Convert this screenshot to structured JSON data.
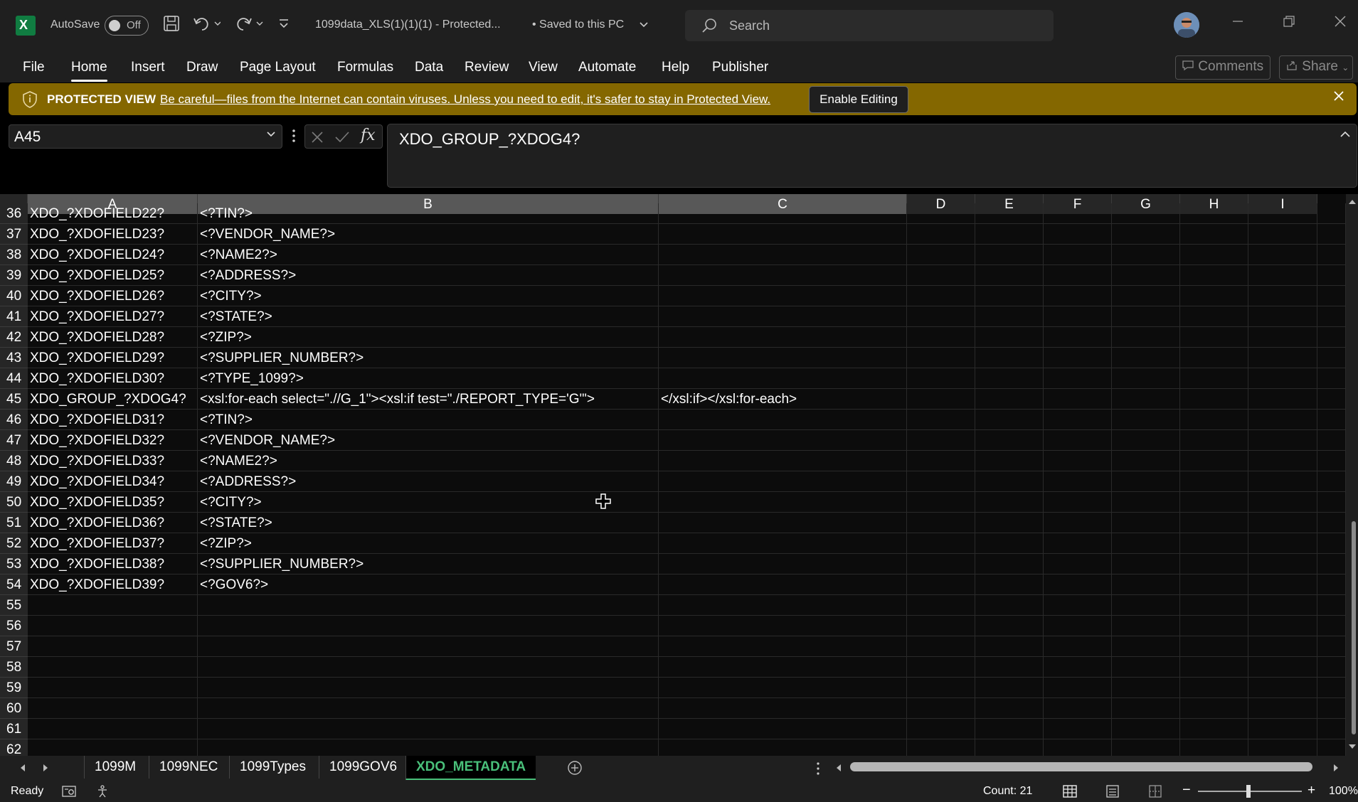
{
  "app": {
    "autosave_label": "AutoSave",
    "autosave_state": "Off",
    "file_title": "1099data_XLS(1)(1)(1)  -  Protected...",
    "save_status": "• Saved to this PC",
    "search_placeholder": "Search"
  },
  "ribbon": {
    "tabs": [
      "File",
      "Home",
      "Insert",
      "Draw",
      "Page Layout",
      "Formulas",
      "Data",
      "Review",
      "View",
      "Automate",
      "Help",
      "Publisher"
    ],
    "active_tab": "Home",
    "comments_label": "Comments",
    "share_label": "Share"
  },
  "protected_view": {
    "title": "PROTECTED VIEW",
    "message": "Be careful—files from the Internet can contain viruses. Unless you need to edit, it's safer to stay in Protected View.",
    "button": "Enable Editing"
  },
  "formula_bar": {
    "name_box": "A45",
    "fx_label": "fx",
    "value": "XDO_GROUP_?XDOG4?"
  },
  "sheet": {
    "columns": [
      "A",
      "B",
      "C",
      "D",
      "E",
      "F",
      "G",
      "H",
      "I"
    ],
    "selected_column": "A",
    "rows": [
      {
        "n": "36",
        "a": "XDO_?XDOFIELD22?",
        "b": "<?TIN?>",
        "c": ""
      },
      {
        "n": "37",
        "a": "XDO_?XDOFIELD23?",
        "b": "<?VENDOR_NAME?>",
        "c": ""
      },
      {
        "n": "38",
        "a": "XDO_?XDOFIELD24?",
        "b": "<?NAME2?>",
        "c": ""
      },
      {
        "n": "39",
        "a": "XDO_?XDOFIELD25?",
        "b": "<?ADDRESS?>",
        "c": ""
      },
      {
        "n": "40",
        "a": "XDO_?XDOFIELD26?",
        "b": "<?CITY?>",
        "c": ""
      },
      {
        "n": "41",
        "a": "XDO_?XDOFIELD27?",
        "b": "<?STATE?>",
        "c": ""
      },
      {
        "n": "42",
        "a": "XDO_?XDOFIELD28?",
        "b": "<?ZIP?>",
        "c": ""
      },
      {
        "n": "43",
        "a": "XDO_?XDOFIELD29?",
        "b": "<?SUPPLIER_NUMBER?>",
        "c": ""
      },
      {
        "n": "44",
        "a": "XDO_?XDOFIELD30?",
        "b": "<?TYPE_1099?>",
        "c": ""
      },
      {
        "n": "45",
        "a": "XDO_GROUP_?XDOG4?",
        "b": "<xsl:for-each select=\".//G_1\"><xsl:if test=\"./REPORT_TYPE='G'\">",
        "c": "</xsl:if></xsl:for-each>"
      },
      {
        "n": "46",
        "a": "XDO_?XDOFIELD31?",
        "b": "<?TIN?>",
        "c": ""
      },
      {
        "n": "47",
        "a": "XDO_?XDOFIELD32?",
        "b": "<?VENDOR_NAME?>",
        "c": ""
      },
      {
        "n": "48",
        "a": "XDO_?XDOFIELD33?",
        "b": "<?NAME2?>",
        "c": ""
      },
      {
        "n": "49",
        "a": "XDO_?XDOFIELD34?",
        "b": "<?ADDRESS?>",
        "c": ""
      },
      {
        "n": "50",
        "a": "XDO_?XDOFIELD35?",
        "b": "<?CITY?>",
        "c": ""
      },
      {
        "n": "51",
        "a": "XDO_?XDOFIELD36?",
        "b": "<?STATE?>",
        "c": ""
      },
      {
        "n": "52",
        "a": "XDO_?XDOFIELD37?",
        "b": "<?ZIP?>",
        "c": ""
      },
      {
        "n": "53",
        "a": "XDO_?XDOFIELD38?",
        "b": "<?SUPPLIER_NUMBER?>",
        "c": ""
      },
      {
        "n": "54",
        "a": "XDO_?XDOFIELD39?",
        "b": "<?GOV6?>",
        "c": ""
      },
      {
        "n": "55",
        "a": "",
        "b": "",
        "c": ""
      },
      {
        "n": "56",
        "a": "",
        "b": "",
        "c": ""
      },
      {
        "n": "57",
        "a": "",
        "b": "",
        "c": ""
      },
      {
        "n": "58",
        "a": "",
        "b": "",
        "c": ""
      },
      {
        "n": "59",
        "a": "",
        "b": "",
        "c": ""
      },
      {
        "n": "60",
        "a": "",
        "b": "",
        "c": ""
      },
      {
        "n": "61",
        "a": "",
        "b": "",
        "c": ""
      },
      {
        "n": "62",
        "a": "",
        "b": "",
        "c": ""
      }
    ]
  },
  "sheet_tabs": [
    "1099M",
    "1099NEC",
    "1099Types",
    "1099GOV6",
    "XDO_METADATA"
  ],
  "active_sheet": "XDO_METADATA",
  "status": {
    "ready": "Ready",
    "count": "Count: 21",
    "zoom": "100%"
  },
  "colors": {
    "protected_bar": "#846700",
    "excel_green": "#107c41",
    "active_sheet_text": "#49c07a"
  }
}
